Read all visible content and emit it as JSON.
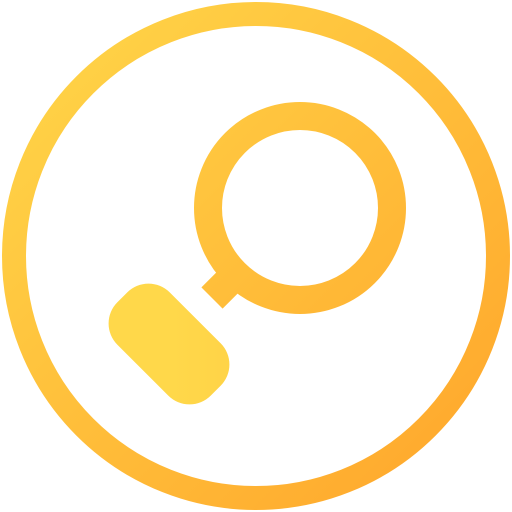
{
  "icon": {
    "name": "search-icon",
    "colors": {
      "gradient_start": "#FFD84A",
      "gradient_end": "#FFA42A",
      "background": "#FFFFFF"
    }
  }
}
